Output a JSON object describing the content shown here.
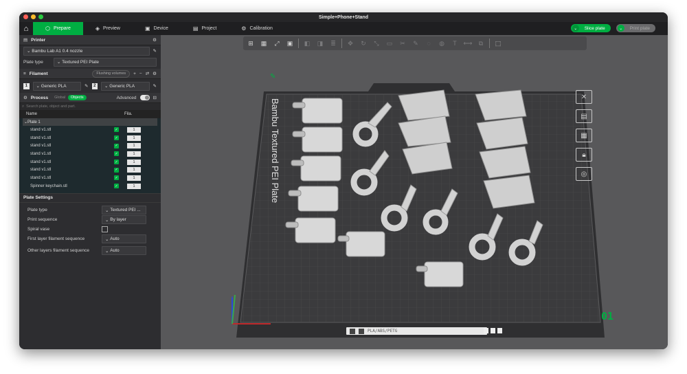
{
  "window": {
    "title": "Simple+Phone+Stand"
  },
  "toolbar": {
    "tabs": [
      {
        "label": "Prepare",
        "icon": "cube-icon"
      },
      {
        "label": "Preview",
        "icon": "layers-icon"
      },
      {
        "label": "Device",
        "icon": "device-icon"
      },
      {
        "label": "Project",
        "icon": "project-icon"
      },
      {
        "label": "Calibration",
        "icon": "calibration-icon"
      }
    ],
    "slice_label": "Slice plate",
    "print_label": "Print plate",
    "colors": {
      "accent": "#00ae42"
    }
  },
  "printer": {
    "section_title": "Printer",
    "name": "Bambu Lab A1 0.4 nozzle",
    "plate_type_label": "Plate type",
    "plate_type_value": "Textured PEI Plate"
  },
  "filament": {
    "section_title": "Filament",
    "flushing_label": "Flushing volumes",
    "items": [
      {
        "index": "1",
        "name": "Generic PLA"
      },
      {
        "index": "2",
        "name": "Generic PLA"
      }
    ]
  },
  "process": {
    "section_title": "Process",
    "global_label": "Global",
    "objects_label": "Objects",
    "advanced_label": "Advanced",
    "search_placeholder": "Search plate, object and part."
  },
  "objects": {
    "col_name": "Name",
    "col_fila": "Fila.",
    "plate_label": "Plate 1",
    "rows": [
      {
        "name": "stand v1.stl",
        "fila": "1"
      },
      {
        "name": "stand v1.stl",
        "fila": "1"
      },
      {
        "name": "stand v1.stl",
        "fila": "1"
      },
      {
        "name": "stand v1.stl",
        "fila": "1"
      },
      {
        "name": "stand v1.stl",
        "fila": "1"
      },
      {
        "name": "stand v1.stl",
        "fila": "1"
      },
      {
        "name": "stand v1.stl",
        "fila": "1"
      },
      {
        "name": "Spinner keychain.stl",
        "fila": "1"
      }
    ]
  },
  "plate_settings": {
    "title": "Plate Settings",
    "plate_type_label": "Plate type",
    "plate_type_value": "Textured PEI ...",
    "print_sequence_label": "Print sequence",
    "print_sequence_value": "By layer",
    "spiral_vase_label": "Spiral vase",
    "first_layer_label": "First layer filament sequence",
    "first_layer_value": "Auto",
    "other_layers_label": "Other layers filament sequence",
    "other_layers_value": "Auto"
  },
  "viewport": {
    "bed_label": "Bambu Textured PEI Plate",
    "plate_number": "01",
    "bottom_bar_text": "PLA/ABS/PETG"
  }
}
